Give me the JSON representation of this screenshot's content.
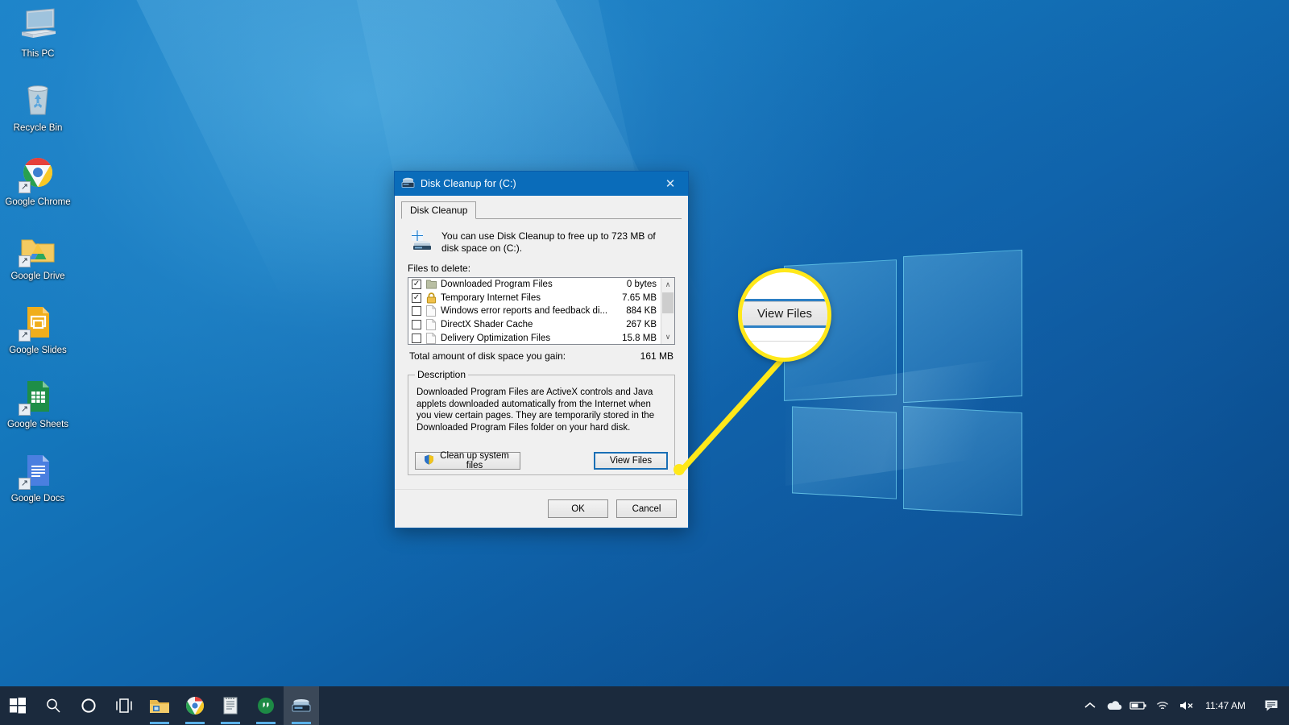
{
  "desktop": {
    "icons": [
      {
        "label": "This PC",
        "icon": "this-pc-icon"
      },
      {
        "label": "Recycle Bin",
        "icon": "recycle-bin-icon"
      },
      {
        "label": "Google Chrome",
        "icon": "google-chrome-icon"
      },
      {
        "label": "Google Drive",
        "icon": "google-drive-icon"
      },
      {
        "label": "Google Slides",
        "icon": "google-slides-icon"
      },
      {
        "label": "Google Sheets",
        "icon": "google-sheets-icon"
      },
      {
        "label": "Google Docs",
        "icon": "google-docs-icon"
      }
    ]
  },
  "dialog": {
    "title": "Disk Cleanup for  (C:)",
    "title_icon": "disk-cleanup-icon",
    "close_label": "✕",
    "tab": "Disk Cleanup",
    "intro_text": "You can use Disk Cleanup to free up to 723 MB of disk space on  (C:).",
    "files_to_delete_label": "Files to delete:",
    "file_rows": [
      {
        "checked": true,
        "icon": "folder-icon",
        "name": "Downloaded Program Files",
        "size": "0 bytes"
      },
      {
        "checked": true,
        "icon": "lock-icon",
        "name": "Temporary Internet Files",
        "size": "7.65 MB"
      },
      {
        "checked": false,
        "icon": "document-icon",
        "name": "Windows error reports and feedback di...",
        "size": "884 KB"
      },
      {
        "checked": false,
        "icon": "document-icon",
        "name": "DirectX Shader Cache",
        "size": "267 KB"
      },
      {
        "checked": false,
        "icon": "document-icon",
        "name": "Delivery Optimization Files",
        "size": "15.8 MB"
      }
    ],
    "total_label": "Total amount of disk space you gain:",
    "total_value": "161 MB",
    "description_legend": "Description",
    "description_body": "Downloaded Program Files are ActiveX controls and Java applets downloaded automatically from the Internet when you view certain pages. They are temporarily stored in the Downloaded Program Files folder on your hard disk.",
    "cleanup_button": "Clean up system files",
    "view_files_button": "View Files",
    "ok_button": "OK",
    "cancel_button": "Cancel",
    "scroll_up": "∧",
    "scroll_down": "∨"
  },
  "callout": {
    "magnified_label": "View Files",
    "ring_color": "#ffe81a"
  },
  "taskbar": {
    "items": [
      {
        "name": "start-button",
        "icon": "windows-logo-icon",
        "running": false,
        "active": false
      },
      {
        "name": "search-button",
        "icon": "search-icon",
        "running": false,
        "active": false
      },
      {
        "name": "cortana-button",
        "icon": "cortana-circle-icon",
        "running": false,
        "active": false
      },
      {
        "name": "task-view-button",
        "icon": "task-view-icon",
        "running": false,
        "active": false
      },
      {
        "name": "file-explorer",
        "icon": "folder-icon",
        "running": true,
        "active": false
      },
      {
        "name": "google-chrome",
        "icon": "chrome-icon",
        "running": true,
        "active": false
      },
      {
        "name": "notepad",
        "icon": "notepad-icon",
        "running": true,
        "active": false
      },
      {
        "name": "hangouts",
        "icon": "hangouts-icon",
        "running": true,
        "active": false
      },
      {
        "name": "disk-cleanup",
        "icon": "disk-cleanup-icon",
        "running": true,
        "active": true
      }
    ],
    "tray": [
      {
        "name": "show-hidden-icons",
        "glyph": "∧"
      },
      {
        "name": "onedrive-icon",
        "glyph": "cloud"
      },
      {
        "name": "battery-icon",
        "glyph": "battery"
      },
      {
        "name": "wifi-icon",
        "glyph": "wifi"
      },
      {
        "name": "volume-muted-icon",
        "glyph": "mute"
      }
    ],
    "clock": "11:47 AM",
    "notifications_icon": "notification-icon"
  }
}
